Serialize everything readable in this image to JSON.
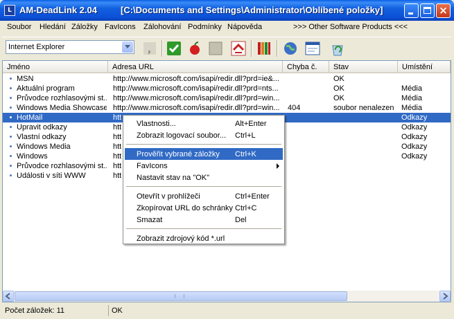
{
  "window": {
    "app_title": "AM-DeadLink 2.04",
    "doc_title": "[C:\\Documents and Settings\\Administrator\\Oblíbené položky]",
    "app_icon_text": "L"
  },
  "menubar": {
    "items": [
      "Soubor",
      "Hledání",
      "Záložky",
      "FavIcons",
      "Zálohování",
      "Podmínky",
      "Nápověda"
    ],
    "promo": ">>> Other Software Products <<<"
  },
  "toolbar": {
    "browser_select": "Internet Explorer",
    "icons": [
      "comma-icon",
      "check-icon",
      "apple-icon",
      "blank-icon",
      "home-icon",
      "books-icon",
      "globe-icon",
      "window-icon",
      "recycle-icon"
    ]
  },
  "list": {
    "columns": [
      "Jméno",
      "Adresa URL",
      "Chyba č.",
      "Stav",
      "Umístění"
    ],
    "rows": [
      {
        "name": "MSN",
        "url": "http://www.microsoft.com/isapi/redir.dll?prd=ie&...",
        "err": "",
        "status": "OK",
        "loc": ""
      },
      {
        "name": "Aktuální program",
        "url": "http://www.microsoft.com/isapi/redir.dll?prd=nts...",
        "err": "",
        "status": "OK",
        "loc": "Média"
      },
      {
        "name": "Průvodce rozhlasovými st...",
        "url": "http://www.microsoft.com/isapi/redir.dll?prd=win...",
        "err": "",
        "status": "OK",
        "loc": "Média"
      },
      {
        "name": "Windows Media Showcase",
        "url": "http://www.microsoft.com/isapi/redir.dll?prd=win...",
        "err": "404",
        "status": "soubor nenalezen",
        "loc": "Média"
      },
      {
        "name": "HotMail",
        "url": "htt",
        "err": "",
        "status": "",
        "loc": "Odkazy",
        "selected": true
      },
      {
        "name": "Upravit odkazy",
        "url": "htt",
        "err": "",
        "status": "",
        "loc": "Odkazy"
      },
      {
        "name": "Vlastní odkazy",
        "url": "htt",
        "err": "",
        "status": "",
        "loc": "Odkazy"
      },
      {
        "name": "Windows Media",
        "url": "htt",
        "err": "",
        "status": "",
        "loc": "Odkazy"
      },
      {
        "name": "Windows",
        "url": "htt",
        "err": "",
        "status": "",
        "loc": "Odkazy"
      },
      {
        "name": "Průvodce rozhlasovými st...",
        "url": "htt",
        "err": "",
        "status": "",
        "loc": ""
      },
      {
        "name": "Události v síti WWW",
        "url": "htt",
        "err": "",
        "status": "",
        "loc": ""
      }
    ]
  },
  "context_menu": {
    "groups": [
      [
        {
          "label": "Vlastnosti...",
          "key": "Alt+Enter"
        },
        {
          "label": "Zobrazit logovací soubor...",
          "key": "Ctrl+L"
        }
      ],
      [
        {
          "label": "Prověřit vybrané záložky",
          "key": "Ctrl+K",
          "highlighted": true
        },
        {
          "label": "FavIcons",
          "key": "",
          "submenu": true
        },
        {
          "label": "Nastavit stav na \"OK\"",
          "key": ""
        }
      ],
      [
        {
          "label": "Otevřít v prohlížeči",
          "key": "Ctrl+Enter"
        },
        {
          "label": "Zkopírovat URL do schránky",
          "key": "Ctrl+C"
        },
        {
          "label": "Smazat",
          "key": "Del"
        }
      ],
      [
        {
          "label": "Zobrazit zdrojový kód *.url",
          "key": ""
        }
      ]
    ]
  },
  "statusbar": {
    "count": "Počet záložek: 11",
    "state": "OK"
  },
  "colors": {
    "selection": "#316ac5",
    "titlebar": "#0b4fd6",
    "face": "#ece9d8"
  }
}
